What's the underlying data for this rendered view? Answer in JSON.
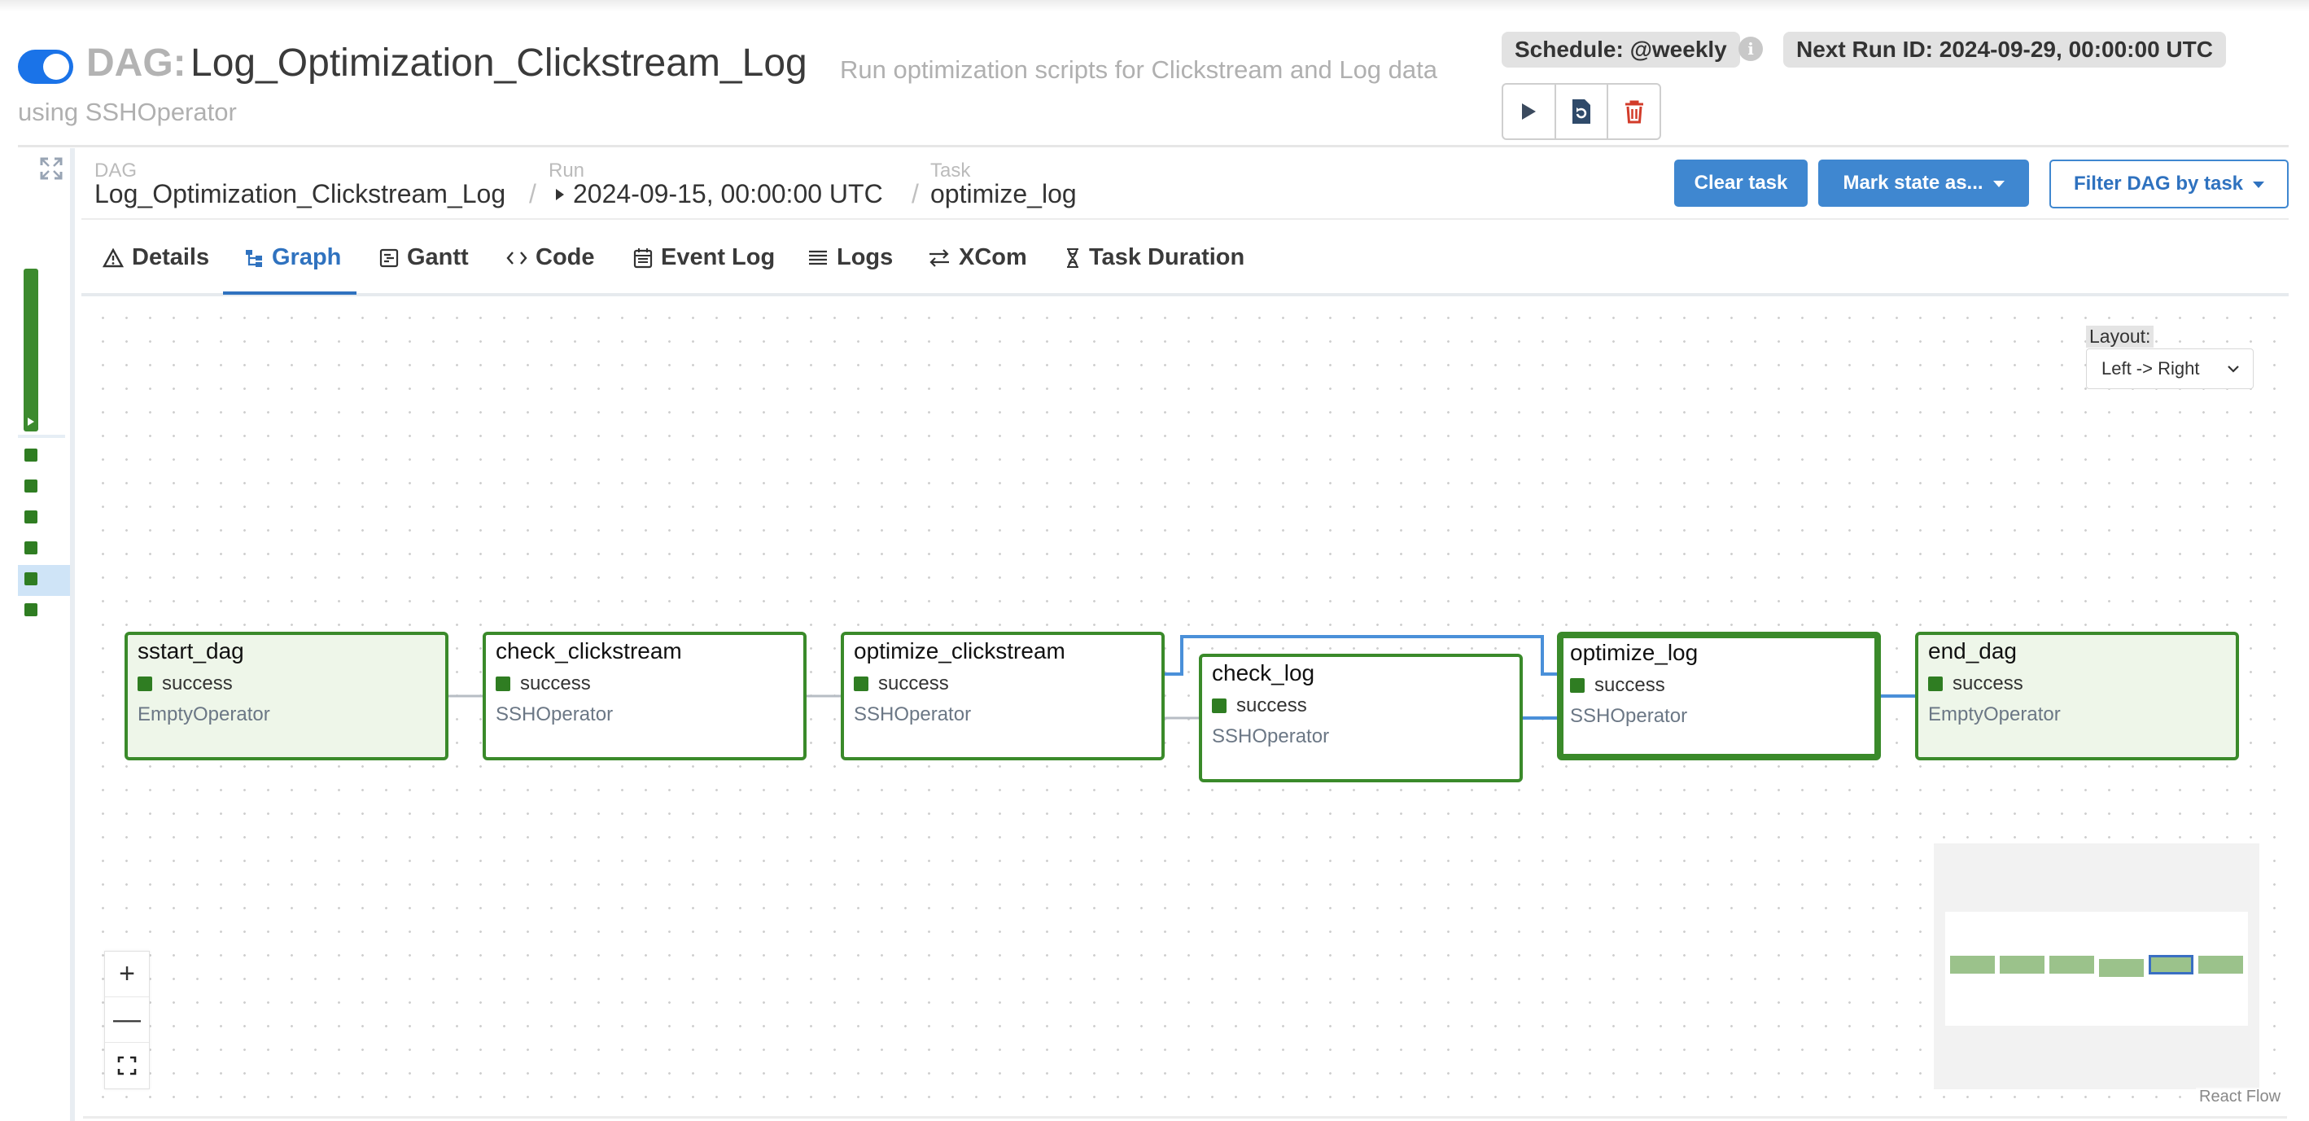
{
  "header": {
    "dag_prefix": "DAG:",
    "dag_name": "Log_Optimization_Clickstream_Log",
    "description_line1": "Run optimization scripts for Clickstream and Log data",
    "description_line2": "using SSHOperator",
    "schedule_badge": "Schedule: @weekly",
    "next_run_badge": "Next Run ID: 2024-09-29, 00:00:00 UTC",
    "info_glyph": "i",
    "toggle_on": true
  },
  "breadcrumb": {
    "dag_label": "DAG",
    "dag_value": "Log_Optimization_Clickstream_Log",
    "run_label": "Run",
    "run_value": "2024-09-15, 00:00:00 UTC",
    "task_label": "Task",
    "task_value": "optimize_log",
    "separator": "/"
  },
  "actions": {
    "clear_task": "Clear task",
    "mark_state": "Mark state as...",
    "filter_dag": "Filter DAG by task"
  },
  "tabs": [
    {
      "label": "Details",
      "icon": "warning-icon"
    },
    {
      "label": "Graph",
      "icon": "graph-icon",
      "active": true
    },
    {
      "label": "Gantt",
      "icon": "gantt-icon"
    },
    {
      "label": "Code",
      "icon": "code-icon"
    },
    {
      "label": "Event Log",
      "icon": "calendar-icon"
    },
    {
      "label": "Logs",
      "icon": "list-icon"
    },
    {
      "label": "XCom",
      "icon": "arrows-icon"
    },
    {
      "label": "Task Duration",
      "icon": "hourglass-icon"
    }
  ],
  "graph": {
    "layout_label": "Layout:",
    "layout_value": "Left -> Right",
    "nodes": [
      {
        "name": "sstart_dag",
        "status": "success",
        "operator": "EmptyOperator"
      },
      {
        "name": "check_clickstream",
        "status": "success",
        "operator": "SSHOperator"
      },
      {
        "name": "optimize_clickstream",
        "status": "success",
        "operator": "SSHOperator"
      },
      {
        "name": "check_log",
        "status": "success",
        "operator": "SSHOperator"
      },
      {
        "name": "optimize_log",
        "status": "success",
        "operator": "SSHOperator",
        "selected": true
      },
      {
        "name": "end_dag",
        "status": "success",
        "operator": "EmptyOperator"
      }
    ],
    "zoom_in": "+",
    "zoom_out": "—",
    "attribution": "React Flow"
  },
  "colors": {
    "success": "#2f7d22",
    "node_border": "#3a8a2a",
    "accent": "#3f87d0",
    "edge_selected": "#4a90d9"
  }
}
